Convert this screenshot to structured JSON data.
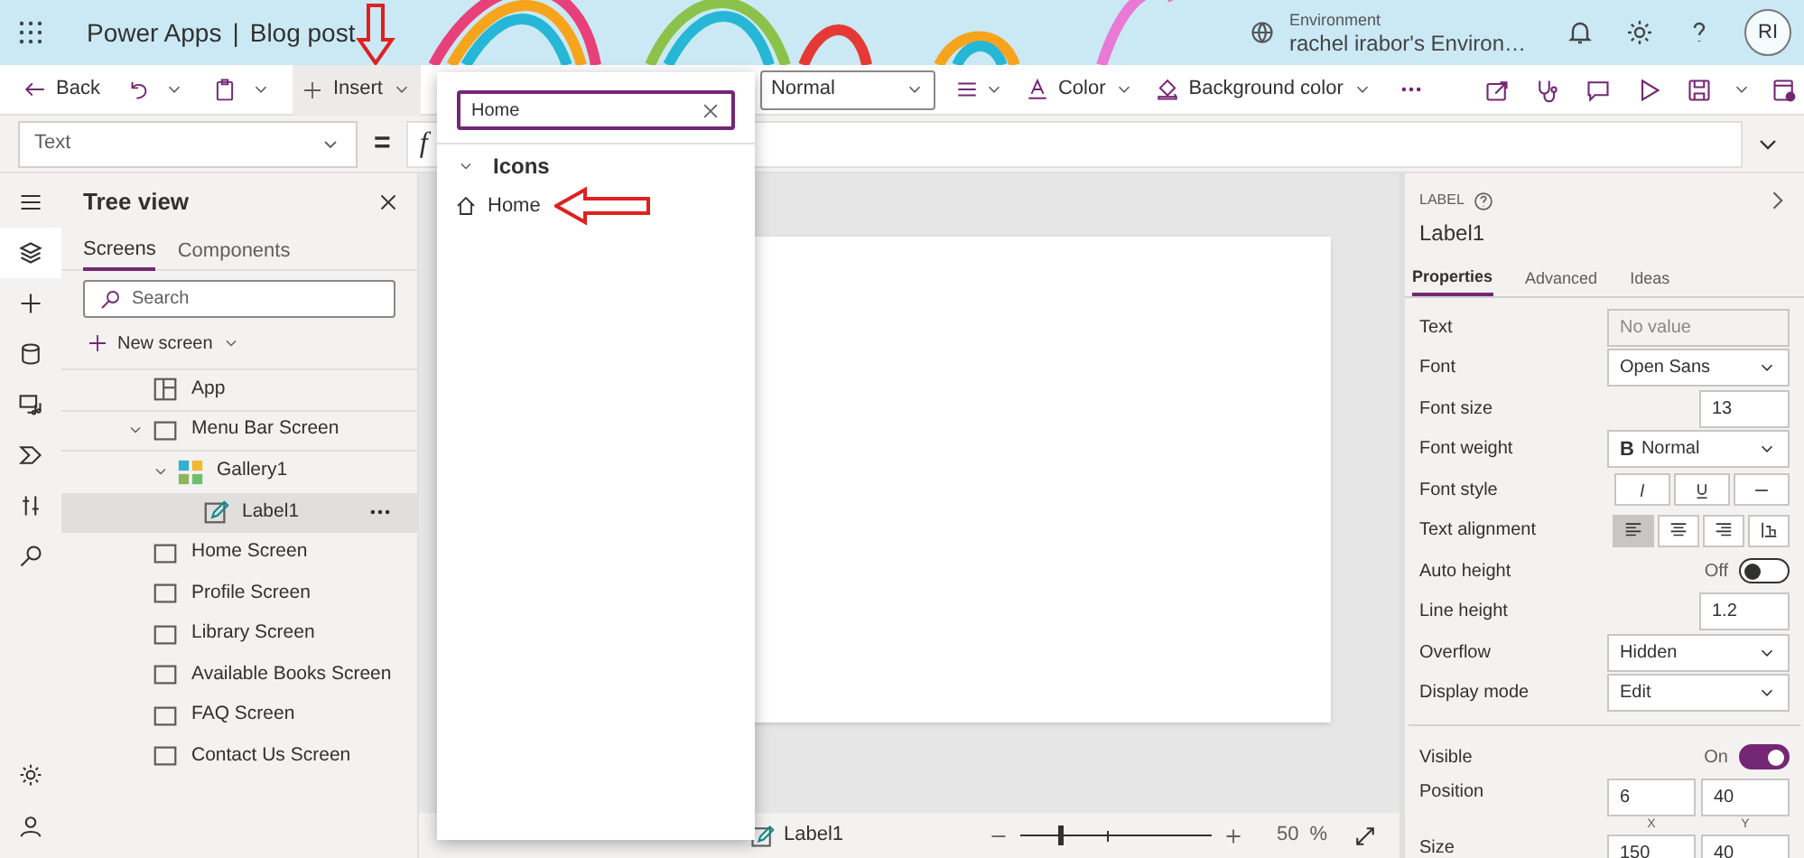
{
  "header": {
    "app_name": "Power Apps",
    "separator": "|",
    "document": "Blog post",
    "environment_label": "Environment",
    "environment_name": "rachel irabor's Environ…",
    "avatar": "RI"
  },
  "toolbar": [
    {
      "kind": "back",
      "label": "Back"
    },
    {
      "kind": "undo"
    },
    {
      "kind": "chevron"
    },
    {
      "kind": "paste"
    },
    {
      "kind": "chevron"
    },
    {
      "kind": "insert",
      "label": "Insert",
      "expanded": true
    },
    {
      "kind": "combo",
      "value": "Normal"
    },
    {
      "kind": "align"
    },
    {
      "kind": "color",
      "label": "Color"
    },
    {
      "kind": "bgcolor",
      "label": "Background color"
    },
    {
      "kind": "more"
    },
    {
      "kind": "share"
    },
    {
      "kind": "checker"
    },
    {
      "kind": "comment"
    },
    {
      "kind": "play"
    },
    {
      "kind": "save"
    },
    {
      "kind": "chevron"
    },
    {
      "kind": "publish"
    }
  ],
  "formula_bar": {
    "property": "Text",
    "equals": "=",
    "function_mark": "f"
  },
  "rail": [
    {
      "kind": "menu",
      "selected": false
    },
    {
      "kind": "layers",
      "selected": true
    },
    {
      "kind": "plus",
      "selected": false
    },
    {
      "kind": "data",
      "selected": false
    },
    {
      "kind": "media",
      "selected": false
    },
    {
      "kind": "flow",
      "selected": false
    },
    {
      "kind": "tools",
      "selected": false
    },
    {
      "kind": "search",
      "selected": false
    }
  ],
  "rail_bottom": [
    {
      "kind": "settings",
      "selected": false
    },
    {
      "kind": "account",
      "selected": false
    }
  ],
  "tree_view": {
    "title": "Tree view",
    "tabs": [
      {
        "label": "Screens",
        "selected": true
      },
      {
        "label": "Components",
        "selected": false
      }
    ],
    "search": {
      "placeholder": "Search"
    },
    "new_screen": "New screen",
    "items": [
      {
        "kind": "app",
        "label": "App",
        "selected": false
      },
      {
        "kind": "screen",
        "label": "Menu Bar Screen",
        "selected": false,
        "expanded": true,
        "children": [
          {
            "kind": "gallery",
            "label": "Gallery1",
            "selected": false,
            "expanded": true,
            "children": [
              {
                "kind": "label",
                "label": "Label1",
                "selected": true
              }
            ]
          }
        ]
      },
      {
        "kind": "screen",
        "label": "Home Screen",
        "selected": false
      },
      {
        "kind": "screen",
        "label": "Profile Screen",
        "selected": false
      },
      {
        "kind": "screen",
        "label": "Library Screen",
        "selected": false
      },
      {
        "kind": "screen",
        "label": "Available Books Screen",
        "selected": false
      },
      {
        "kind": "screen",
        "label": "FAQ Screen",
        "selected": false
      },
      {
        "kind": "screen",
        "label": "Contact Us Screen",
        "selected": false
      }
    ]
  },
  "status_bar": {
    "selected_control": "Label1",
    "zoom": {
      "level": 0.2
    },
    "zoom_value": "50",
    "zoom_unit": "%"
  },
  "properties_panel": {
    "type": "LABEL",
    "name": "Label1",
    "tabs": [
      {
        "label": "Properties",
        "selected": true
      },
      {
        "label": "Advanced",
        "selected": false
      },
      {
        "label": "Ideas",
        "selected": false
      }
    ],
    "rows": [
      {
        "label": "Text",
        "kind": "readonly",
        "placeholder": "No value"
      },
      {
        "label": "Font",
        "kind": "dropdown",
        "value": "Open Sans"
      },
      {
        "label": "Font size",
        "kind": "number",
        "value": "13"
      },
      {
        "label": "Font weight",
        "kind": "dropdown",
        "value": "Normal",
        "mark": "B"
      },
      {
        "label": "Font style",
        "kind": "buttons",
        "options": [
          {
            "kind": "italic",
            "selected": false
          },
          {
            "kind": "underline",
            "selected": false
          },
          {
            "kind": "strike",
            "selected": false
          }
        ]
      },
      {
        "label": "Text alignment",
        "kind": "buttons",
        "options": [
          {
            "kind": "left",
            "selected": true
          },
          {
            "kind": "center",
            "selected": false
          },
          {
            "kind": "right",
            "selected": false
          },
          {
            "kind": "vertical",
            "selected": false
          }
        ]
      },
      {
        "label": "Auto height",
        "kind": "toggle",
        "state": "Off",
        "on": false
      },
      {
        "label": "Line height",
        "kind": "number",
        "value": "1.2"
      },
      {
        "label": "Overflow",
        "kind": "dropdown",
        "value": "Hidden"
      },
      {
        "label": "Display mode",
        "kind": "dropdown",
        "value": "Edit"
      },
      {
        "kind": "divider"
      },
      {
        "label": "Visible",
        "kind": "toggle",
        "state": "On",
        "on": true
      },
      {
        "label": "Position",
        "kind": "pair",
        "values": [
          "6",
          "40"
        ],
        "captions": [
          "X",
          "Y"
        ]
      },
      {
        "label": "Size",
        "kind": "pair",
        "values": [
          "150",
          "40"
        ]
      }
    ]
  },
  "insert_menu": {
    "search": {
      "value": "Home"
    },
    "groups": [
      {
        "label": "Icons",
        "expanded": true,
        "items": [
          {
            "kind": "home",
            "label": "Home"
          }
        ]
      }
    ]
  }
}
